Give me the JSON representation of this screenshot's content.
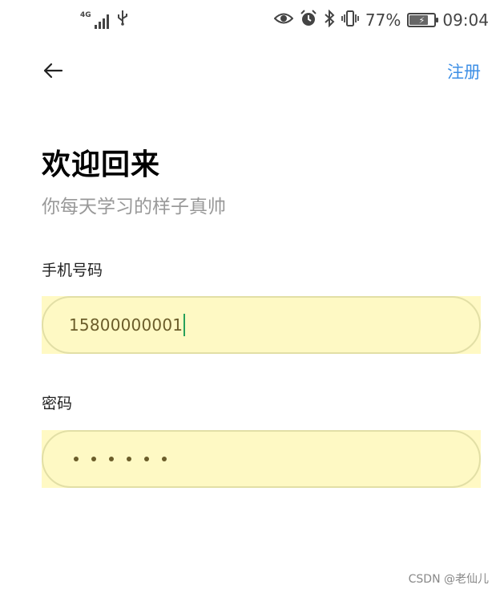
{
  "status_bar": {
    "network_type": "4G",
    "battery_percent_text": "77%",
    "battery_level": 0.77,
    "time": "09:04",
    "icons": [
      "signal-icon",
      "usb-icon",
      "eye-icon",
      "alarm-icon",
      "bluetooth-icon",
      "vibrate-icon",
      "battery-icon"
    ]
  },
  "header": {
    "back_icon": "arrow-left-icon",
    "register_label": "注册"
  },
  "main": {
    "title": "欢迎回来",
    "subtitle": "你每天学习的样子真帅",
    "phone_label": "手机号码",
    "phone_value": "15800000001",
    "password_label": "密码",
    "password_length": 6
  },
  "footer": {
    "watermark": "CSDN @老仙儿"
  },
  "colors": {
    "accent": "#3d8fe6",
    "field_fill": "#fef9c4",
    "caret": "#27a05a"
  }
}
